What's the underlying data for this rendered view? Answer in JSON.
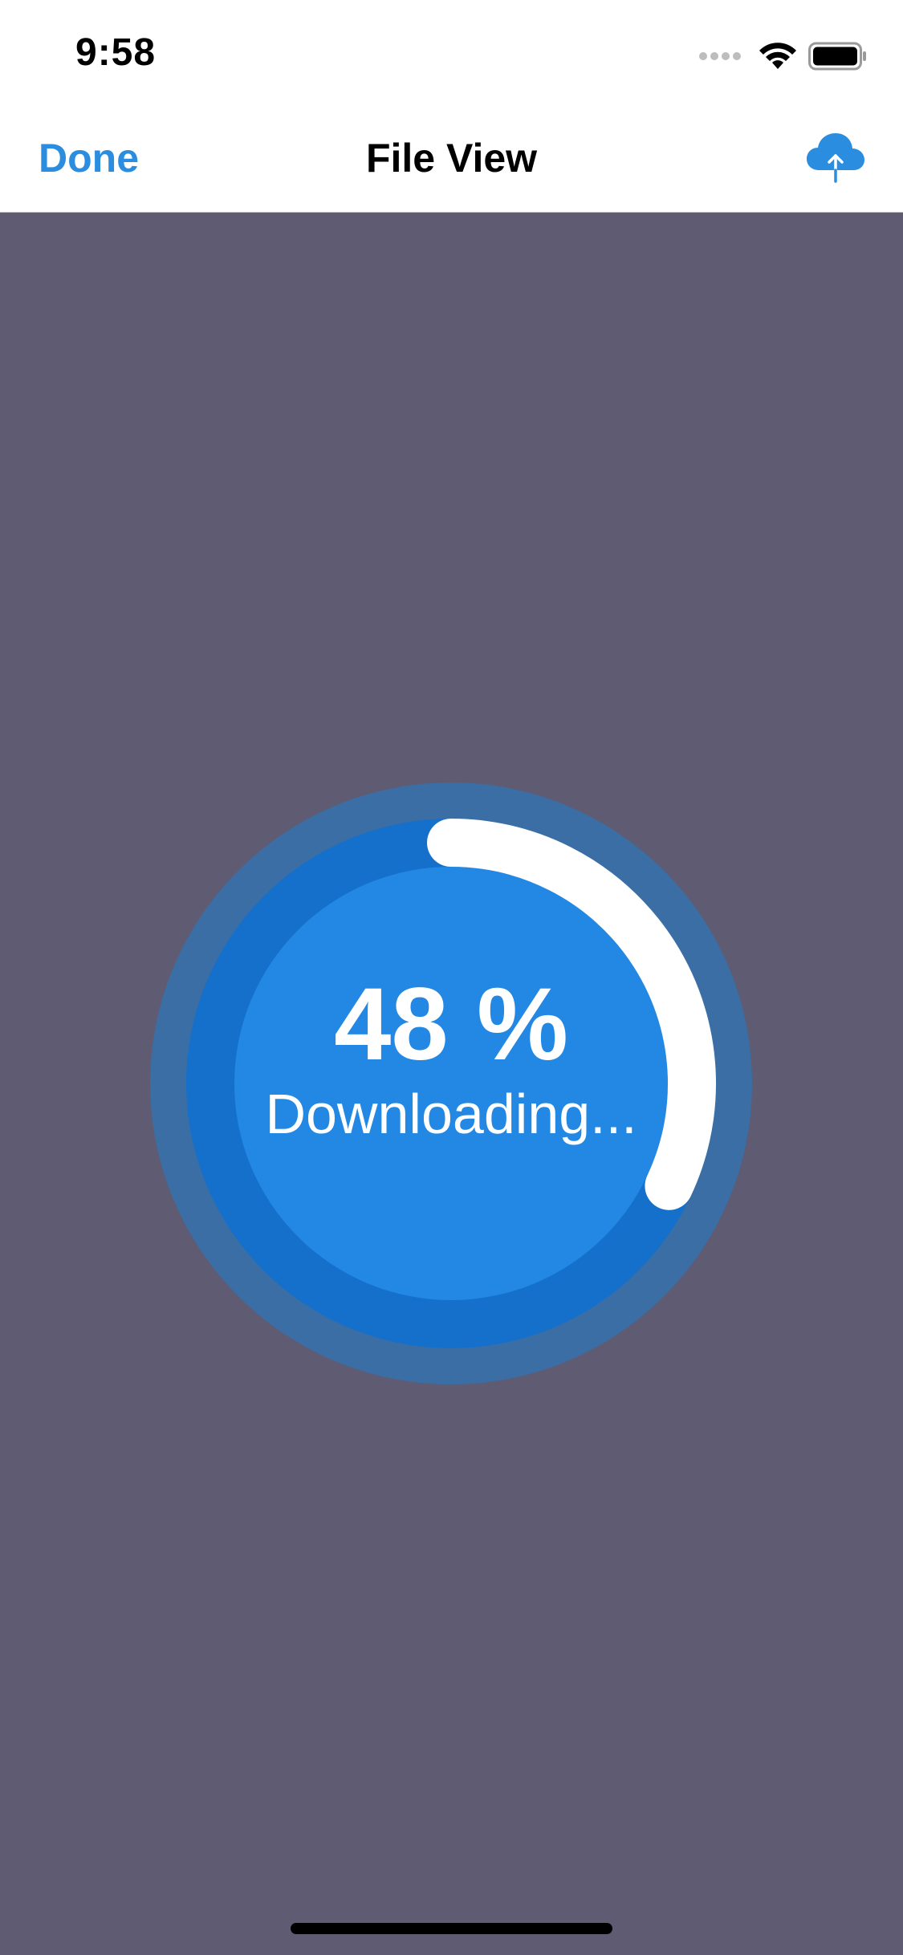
{
  "status_bar": {
    "time": "9:58",
    "icons": [
      "signal-icon",
      "wifi-icon",
      "battery-icon"
    ]
  },
  "nav": {
    "done_label": "Done",
    "title": "File View",
    "upload_icon": "cloud-upload-icon"
  },
  "progress": {
    "value": 0.48,
    "percent_label": "48 %",
    "status_label": "Downloading..."
  },
  "colors": {
    "background": "#5f5b72",
    "accent": "#2a8de0",
    "ring_outer": "#3a6ea4",
    "ring_mid": "#1570cc",
    "ring_inner": "#2288e4",
    "progress_arc": "#ffffff"
  }
}
